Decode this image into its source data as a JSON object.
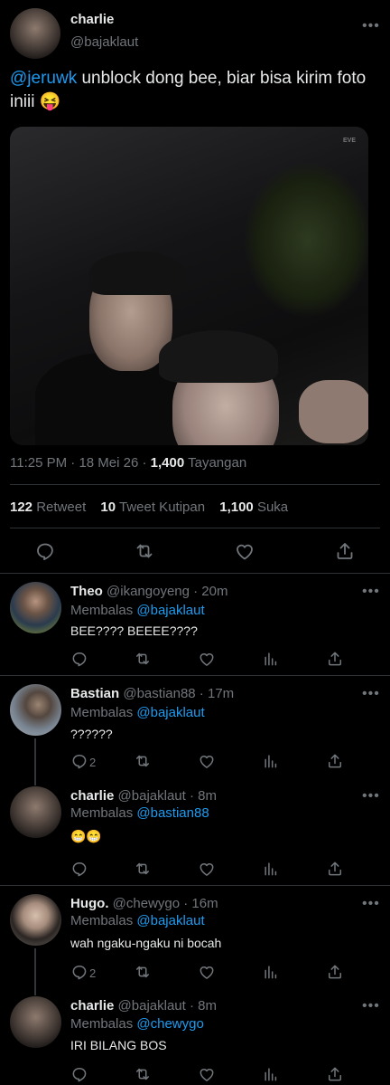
{
  "main_tweet": {
    "name": "charlie",
    "handle": "@bajaklaut",
    "mention": "@jeruwk",
    "text": "unblock dong bee, biar bisa kirim foto iniii",
    "emoji": "😝",
    "time": "11:25 PM",
    "sep": "·",
    "date": "18 Mei 26",
    "views_count": "1,400",
    "views_label": "Tayangan",
    "retweet_count": "122",
    "retweet_label": "Retweet",
    "quote_count": "10",
    "quote_label": "Tweet Kutipan",
    "like_count": "1,100",
    "like_label": "Suka",
    "photo_watermark": "EVE"
  },
  "replies": [
    {
      "name": "Theo",
      "handle": "@ikangoyeng · 20m",
      "replying_label": "Membalas",
      "replying_to": "@bajaklaut",
      "text": "BEE???? BEEEE????",
      "reply_count": ""
    },
    {
      "name": "Bastian",
      "handle": "@bastian88 · 17m",
      "replying_label": "Membalas",
      "replying_to": "@bajaklaut",
      "text": "??????",
      "reply_count": "2"
    },
    {
      "name": "charlie",
      "handle": "@bajaklaut · 8m",
      "replying_label": "Membalas",
      "replying_to": "@bastian88",
      "text": "😁😁",
      "reply_count": ""
    },
    {
      "name": "Hugo.",
      "handle": "@chewygo · 16m",
      "replying_label": "Membalas",
      "replying_to": "@bajaklaut",
      "text": "wah ngaku-ngaku ni bocah",
      "reply_count": "2"
    },
    {
      "name": "charlie",
      "handle": "@bajaklaut · 8m",
      "replying_label": "Membalas",
      "replying_to": "@chewygo",
      "text": "IRI BILANG BOS",
      "reply_count": ""
    }
  ],
  "more_glyph": "•••",
  "colors": {
    "background": "#000000",
    "text": "#e7e9ea",
    "muted": "#71767b",
    "link": "#1d9bf0",
    "divider": "#2f3336"
  },
  "icons": [
    "reply-icon",
    "retweet-icon",
    "like-icon",
    "views-icon",
    "share-icon",
    "more-icon"
  ]
}
